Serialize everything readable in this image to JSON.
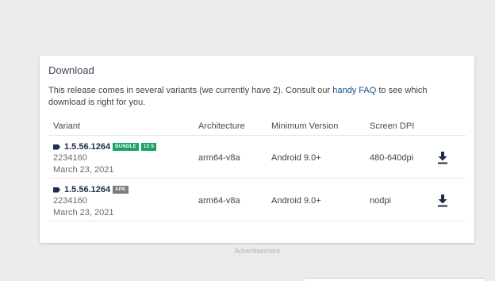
{
  "download": {
    "title": "Download",
    "intro_before": "This release comes in several variants (we currently have 2). Consult our ",
    "intro_link": "handy FAQ",
    "intro_after": " to see which download is right for you.",
    "headers": {
      "variant": "Variant",
      "architecture": "Architecture",
      "min_version": "Minimum Version",
      "dpi": "Screen DPI"
    },
    "rows": [
      {
        "version": "1.5.56.1264",
        "badges": [
          "BUNDLE",
          "13 S"
        ],
        "code": "2234160",
        "date": "March 23, 2021",
        "architecture": "arm64-v8a",
        "min_version": "Android 9.0+",
        "dpi": "480-640dpi"
      },
      {
        "version": "1.5.56.1264",
        "badges": [
          "APK"
        ],
        "code": "2234160",
        "date": "March 23, 2021",
        "architecture": "arm64-v8a",
        "min_version": "Android 9.0+",
        "dpi": "nodpi"
      }
    ]
  },
  "advertisement": "Advertisement",
  "colors": {
    "brand_dark": "#1f2d4d",
    "bundle_badge": "#1aa260",
    "apk_badge": "#7d7d7d",
    "link": "#1a4e8a"
  },
  "icons": {
    "variant": "tag-icon",
    "download": "download-icon"
  }
}
